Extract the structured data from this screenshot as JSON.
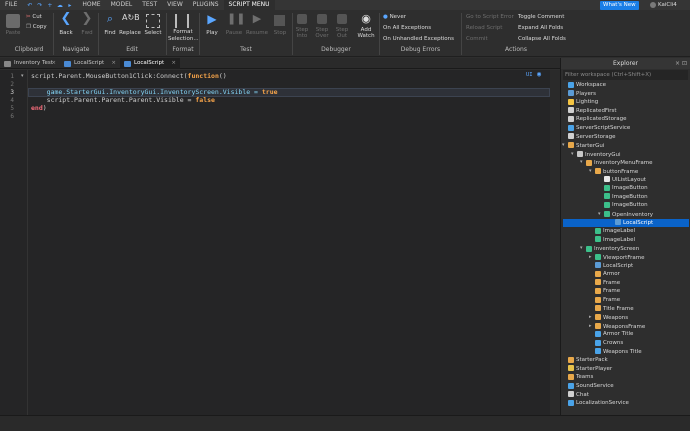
{
  "menubar": {
    "file": "FILE",
    "tabs": [
      "HOME",
      "MODEL",
      "TEST",
      "VIEW",
      "PLUGINS",
      "SCRIPT MENU"
    ],
    "whats_new": "What's New",
    "user": "KaiCli4"
  },
  "ribbon": {
    "clipboard": {
      "paste": "Paste",
      "cut": "Cut",
      "copy": "Copy",
      "group": "Clipboard"
    },
    "navigate": {
      "back": "Back",
      "fwd": "Fwd",
      "group": "Navigate"
    },
    "edit": {
      "find": "Find",
      "replace": "Replace",
      "select": "Select",
      "group": "Edit"
    },
    "format": {
      "format_selection": "Format Selection...",
      "group": "Format"
    },
    "test": {
      "play": "Play",
      "pause": "Pause",
      "resume": "Resume",
      "stop": "Stop",
      "group": "Test"
    },
    "debugger": {
      "step_into": "Step Into",
      "step_over": "Step Over",
      "step_out": "Step Out",
      "add_watch": "Add Watch",
      "group": "Debugger"
    },
    "debug_errors": {
      "never": "Never",
      "on_all": "On All Exceptions",
      "on_unhandled": "On Unhandled Exceptions",
      "group": "Debug Errors"
    },
    "actions": {
      "goto_script_error": "Go to Script Error",
      "reload_script": "Reload Script",
      "commit": "Commit",
      "toggle_comment": "Toggle Comment",
      "expand_all": "Expand All Folds",
      "collapse_all": "Collapse All Folds",
      "group": "Actions"
    }
  },
  "doc_tabs": [
    "Inventory Test",
    "LocalScript",
    "LocalScript"
  ],
  "editor": {
    "line_numbers": [
      "1",
      "2",
      "3",
      "4",
      "5",
      "6"
    ],
    "lines": {
      "l1a": "script.Parent.MouseButton1Click:Connect(",
      "l1b": "function",
      "l1c": "()",
      "l3a": "    game.StarterGui.InventoryGui.InventoryScreen.Visible = ",
      "l3b": "true",
      "l4a": "    script.Parent.Parent.Parent.Visible = ",
      "l4b": "false",
      "l5": "end",
      "l5b": ")"
    },
    "ui_label": "UI"
  },
  "explorer": {
    "title": "Explorer",
    "filter_placeholder": "Filter workspace (Ctrl+Shift+X)",
    "items": [
      {
        "label": "Workspace",
        "color": "#4aa3e8"
      },
      {
        "label": "Players",
        "color": "#5b9bd5"
      },
      {
        "label": "Lighting",
        "color": "#f5c542"
      },
      {
        "label": "ReplicatedFirst",
        "color": "#d0d0d0"
      },
      {
        "label": "ReplicatedStorage",
        "color": "#d0d0d0"
      },
      {
        "label": "ServerScriptService",
        "color": "#4aa3e8"
      },
      {
        "label": "ServerStorage",
        "color": "#d0d0d0"
      },
      {
        "label": "StarterGui",
        "color": "#e8a84a"
      },
      {
        "label": "InventoryGui",
        "color": "#c8c8c8"
      },
      {
        "label": "InventoryMenuFrame",
        "color": "#e8a84a"
      },
      {
        "label": "buttonFrame",
        "color": "#e8a84a"
      },
      {
        "label": "UIListLayout",
        "color": "#e8e8e8"
      },
      {
        "label": "ImageButton",
        "color": "#3cbf8a"
      },
      {
        "label": "ImageButton",
        "color": "#3cbf8a"
      },
      {
        "label": "ImageButton",
        "color": "#3cbf8a"
      },
      {
        "label": "OpenInventory",
        "color": "#3cbf8a"
      },
      {
        "label": "LocalScript",
        "color": "#5b9bd5"
      },
      {
        "label": "ImageLabel",
        "color": "#3cbf8a"
      },
      {
        "label": "ImageLabel",
        "color": "#3cbf8a"
      },
      {
        "label": "InventoryScreen",
        "color": "#3cbf8a"
      },
      {
        "label": "ViewportFrame",
        "color": "#3cbf8a"
      },
      {
        "label": "LocalScript",
        "color": "#5b9bd5"
      },
      {
        "label": "Armor",
        "color": "#e8a84a"
      },
      {
        "label": "Frame",
        "color": "#e8a84a"
      },
      {
        "label": "Frame",
        "color": "#e8a84a"
      },
      {
        "label": "Frame",
        "color": "#e8a84a"
      },
      {
        "label": "Title Frame",
        "color": "#e8a84a"
      },
      {
        "label": "Weapons",
        "color": "#e8a84a"
      },
      {
        "label": "WeaponsFrame",
        "color": "#e8a84a"
      },
      {
        "label": "Armor Title",
        "color": "#4aa3e8"
      },
      {
        "label": "Crowns",
        "color": "#4aa3e8"
      },
      {
        "label": "Weapons Title",
        "color": "#4aa3e8"
      },
      {
        "label": "StarterPack",
        "color": "#e8a84a"
      },
      {
        "label": "StarterPlayer",
        "color": "#e8c24a"
      },
      {
        "label": "Teams",
        "color": "#e8a84a"
      },
      {
        "label": "SoundService",
        "color": "#4aa3e8"
      },
      {
        "label": "Chat",
        "color": "#d0d0d0"
      },
      {
        "label": "LocalizationService",
        "color": "#4aa3e8"
      }
    ]
  }
}
